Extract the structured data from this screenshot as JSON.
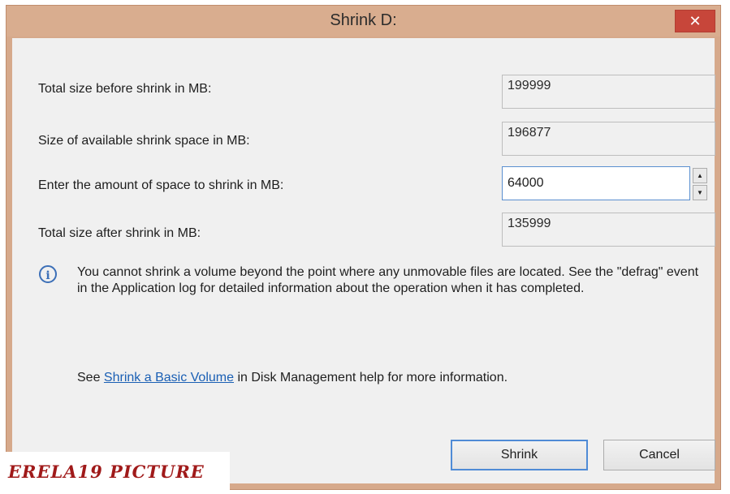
{
  "window": {
    "title": "Shrink D:",
    "close_label": "✕"
  },
  "rows": [
    {
      "label": "Total size before shrink in MB:",
      "value": "199999"
    },
    {
      "label": "Size of available shrink space in MB:",
      "value": "196877"
    },
    {
      "label": "Enter the amount of space to shrink in MB:",
      "value": "64000"
    },
    {
      "label": "Total size after shrink in MB:",
      "value": "135999"
    }
  ],
  "spinner": {
    "up": "▲",
    "down": "▼"
  },
  "info": {
    "icon": "info-icon",
    "text": "You cannot shrink a volume beyond the point where any unmovable files are located. See the \"defrag\" event in the Application log for detailed information about the operation when it has completed."
  },
  "help": {
    "prefix": "See ",
    "link": "Shrink a Basic Volume",
    "suffix": " in Disk Management help for more information."
  },
  "buttons": {
    "shrink": "Shrink",
    "cancel": "Cancel"
  },
  "watermark": "ERELA19 PICTURE",
  "colors": {
    "titlebar": "#d9ad8f",
    "close": "#c7463a",
    "link": "#1a5fb4",
    "watermark": "#a01a1a"
  }
}
